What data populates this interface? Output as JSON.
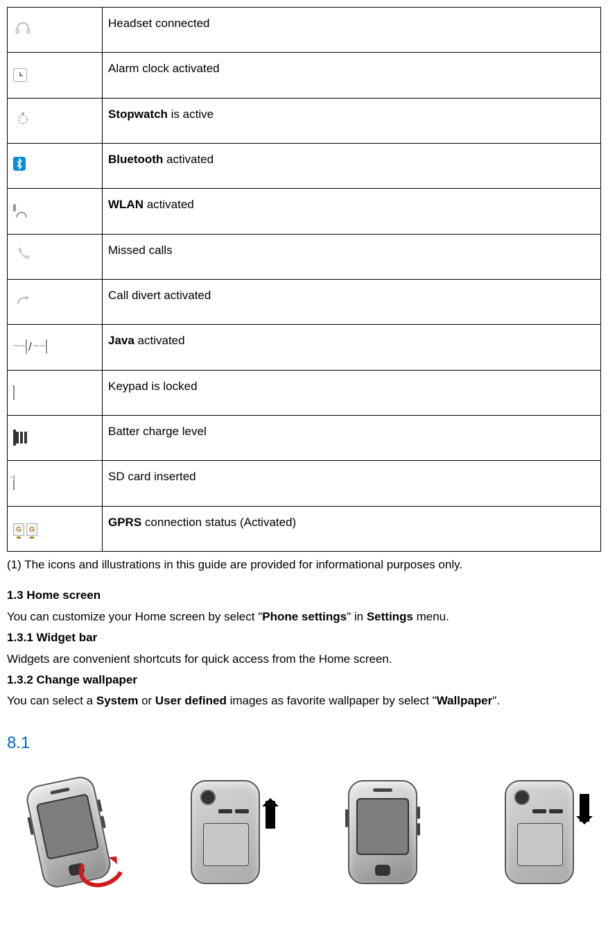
{
  "table": {
    "rows": [
      {
        "icon": "headset-icon",
        "desc_plain": "Headset connected"
      },
      {
        "icon": "alarm-icon",
        "desc_plain": "Alarm clock activated"
      },
      {
        "icon": "stopwatch-icon",
        "desc_bold": "Stopwatch",
        "desc_after": " is active"
      },
      {
        "icon": "bluetooth-icon",
        "desc_bold": "Bluetooth",
        "desc_after": " activated"
      },
      {
        "icon": "wlan-icon",
        "desc_bold": "WLAN",
        "desc_after": " activated"
      },
      {
        "icon": "missed-calls-icon",
        "desc_plain": "Missed calls"
      },
      {
        "icon": "call-divert-icon",
        "desc_plain": "Call divert activated"
      },
      {
        "icon": "java-icon",
        "desc_bold": "Java",
        "desc_after": " activated"
      },
      {
        "icon": "keypad-locked-icon",
        "desc_plain": "Keypad is locked"
      },
      {
        "icon": "battery-level-icon",
        "desc_plain": "Batter charge level"
      },
      {
        "icon": "sd-card-icon",
        "desc_plain": "SD card inserted"
      },
      {
        "icon": "gprs-icon",
        "desc_bold": "GPRS",
        "desc_after": " connection status (Activated)"
      }
    ]
  },
  "note_1": "(1) The icons and illustrations in this guide are provided for informational purposes only.",
  "section_1_3": {
    "title": "1.3 Home screen",
    "body_before": "You can customize your Home screen by select \"",
    "body_bold1": "Phone settings",
    "body_mid": "\" in ",
    "body_bold2": "Settings",
    "body_after": " menu."
  },
  "section_1_3_1": {
    "title": "1.3.1 Widget bar",
    "body": "Widgets are convenient shortcuts for quick access from the Home screen."
  },
  "section_1_3_2": {
    "title": "1.3.2 Change wallpaper",
    "body_before": "You can select a ",
    "body_bold1": "System",
    "body_mid1": " or ",
    "body_bold2": "User defined",
    "body_mid2": " images as favorite wallpaper by select \"",
    "body_bold3": "Wallpaper",
    "body_after": "\"."
  },
  "link_label": "8.1",
  "illustrations": [
    {
      "name": "phone-front-tilt-remove-cover"
    },
    {
      "name": "phone-back-up-arrow"
    },
    {
      "name": "phone-front-straight"
    },
    {
      "name": "phone-back-down-arrow"
    }
  ]
}
